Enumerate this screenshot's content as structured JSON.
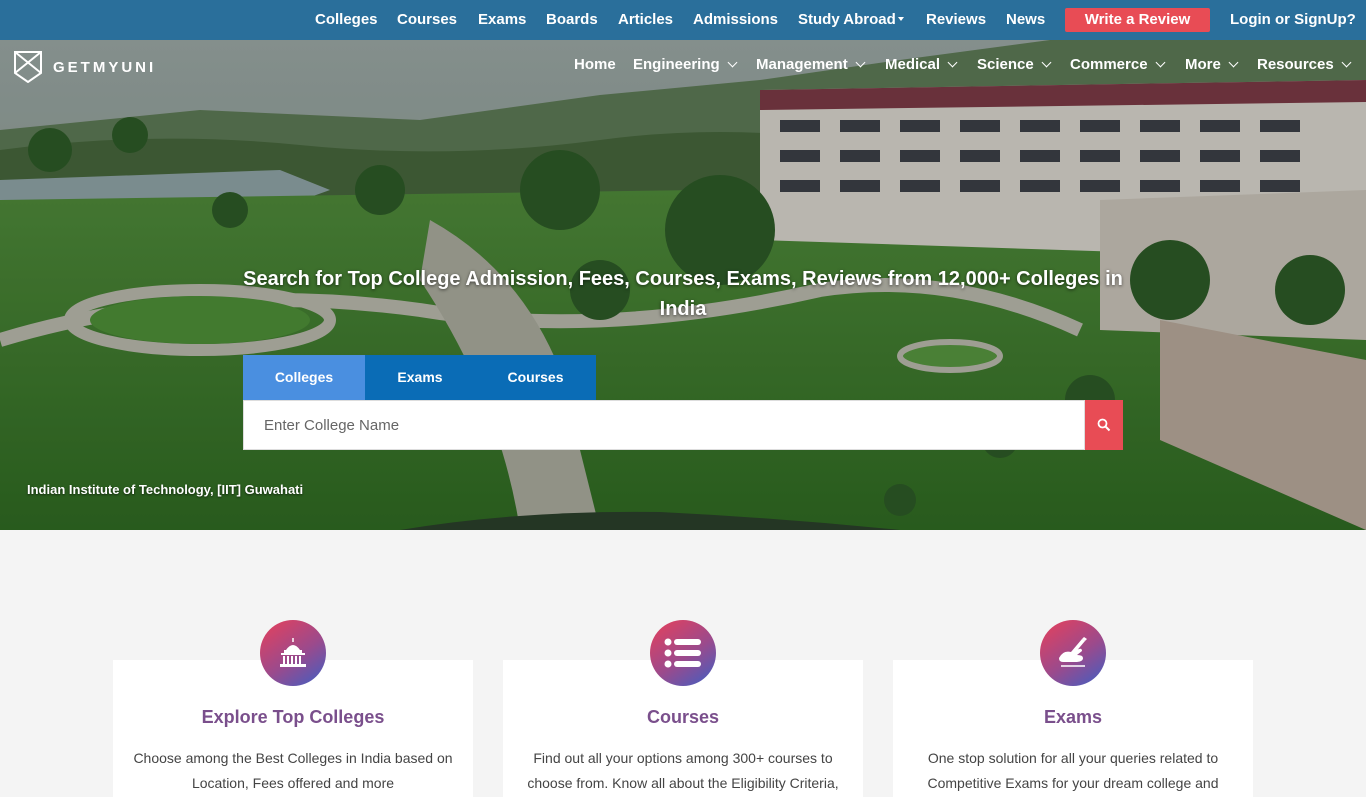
{
  "topbar": {
    "links": [
      "Colleges",
      "Courses",
      "Exams",
      "Boards",
      "Articles",
      "Admissions",
      "Study Abroad",
      "Reviews",
      "News"
    ],
    "write_review": "Write a Review",
    "login": "Login or SignUp?"
  },
  "brand": {
    "name": "GETMYUNI"
  },
  "nav": {
    "home": "Home",
    "engineering": "Engineering",
    "management": "Management",
    "medical": "Medical",
    "science": "Science",
    "commerce": "Commerce",
    "more": "More",
    "resources": "Resources"
  },
  "hero": {
    "headline": "Search for Top College Admission, Fees, Courses, Exams, Reviews from 12,000+ Colleges in India",
    "tabs": [
      "Colleges",
      "Exams",
      "Courses"
    ],
    "search_placeholder": "Enter College Name",
    "caption": "Indian Institute of Technology, [IIT] Guwahati"
  },
  "cards": [
    {
      "title": "Explore Top Colleges",
      "text": "Choose among the Best Colleges in India based on Location, Fees offered and more",
      "icon": "college-building-icon"
    },
    {
      "title": "Courses",
      "text": "Find out all your options among 300+ courses to choose from. Know all about the Eligibility Criteria,",
      "icon": "list-icon"
    },
    {
      "title": "Exams",
      "text": "One stop solution for all your queries related to Competitive Exams for your dream college and",
      "icon": "writing-hand-icon"
    }
  ],
  "colors": {
    "topbar": "#2a6f9b",
    "accent_red": "#e84c55",
    "tab_active": "#4a8fe0",
    "tab_inactive": "#0a6cb6",
    "card_title": "#7a4f8c"
  }
}
